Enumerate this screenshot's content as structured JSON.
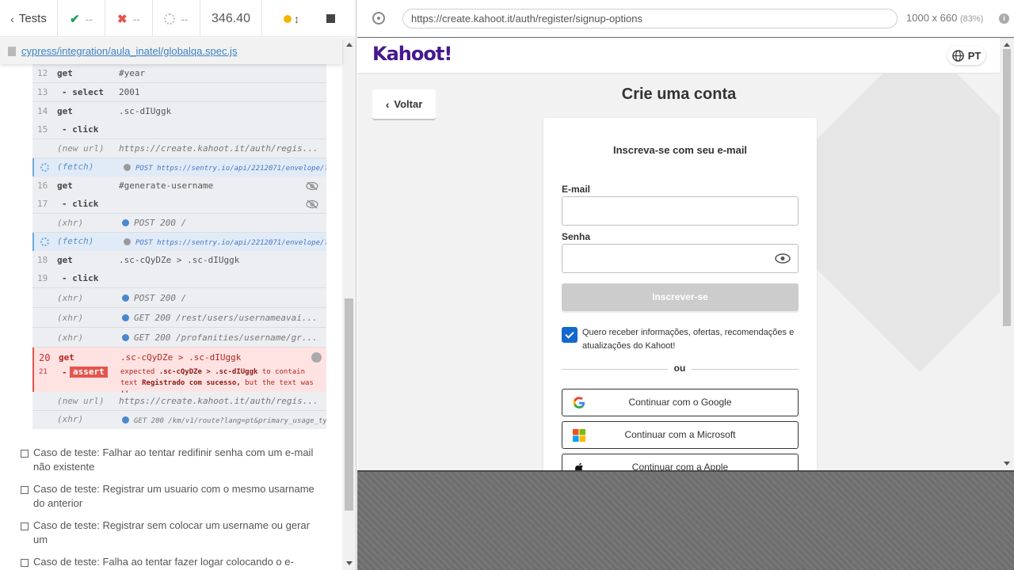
{
  "topbar": {
    "tests_label": "Tests",
    "passed": "--",
    "failed": "--",
    "pending": "--",
    "duration": "346.40"
  },
  "spec": {
    "path": "cypress/integration/aula_inatel/globalqa.spec.js"
  },
  "command_log": [
    {
      "num": "12",
      "cmd": "get",
      "arg": "#year"
    },
    {
      "num": "13",
      "cmd": "- select",
      "arg": "2001"
    },
    {
      "num": "14",
      "cmd": "get",
      "arg": ".sc-dIUggk"
    },
    {
      "num": "15",
      "cmd": "- click",
      "arg": ""
    },
    {
      "num": "",
      "cmd": "(new url)",
      "arg": "https://create.kahoot.it/auth/regis..."
    },
    {
      "num": "",
      "cmd": "(fetch)",
      "arg": "POST https://sentry.io/api/2212071/envelope/?s..."
    },
    {
      "num": "16",
      "cmd": "get",
      "arg": "#generate-username"
    },
    {
      "num": "17",
      "cmd": "- click",
      "arg": ""
    },
    {
      "num": "",
      "cmd": "(xhr)",
      "arg": "POST 200 /"
    },
    {
      "num": "",
      "cmd": "(fetch)",
      "arg": "POST https://sentry.io/api/2212071/envelope/?s..."
    },
    {
      "num": "18",
      "cmd": "get",
      "arg": ".sc-cQyDZe > .sc-dIUggk"
    },
    {
      "num": "19",
      "cmd": "- click",
      "arg": ""
    },
    {
      "num": "",
      "cmd": "(xhr)",
      "arg": "POST 200 /"
    },
    {
      "num": "",
      "cmd": "(xhr)",
      "arg": "GET 200 /rest/users/usernameavai..."
    },
    {
      "num": "",
      "cmd": "(xhr)",
      "arg": "GET 200 /profanities/username/gr..."
    },
    {
      "num": "20",
      "cmd": "get",
      "arg": ".sc-cQyDZe > .sc-dIUggk"
    },
    {
      "num": "21",
      "cmd": "-",
      "arg": "assert"
    },
    {
      "num": "",
      "cmd": "(new url)",
      "arg": "https://create.kahoot.it/auth/regis..."
    },
    {
      "num": "",
      "cmd": "(xhr)",
      "arg": "GET 200 /km/v1/route?lang=pt&primary_usage_typ..."
    }
  ],
  "assertion": {
    "pre": "expected",
    "selector": ".sc-cQyDZe > .sc-dIUggk",
    "mid": "to contain text",
    "expected_text": "Registrado com sucesso,",
    "post": "but the text was",
    "actual": "''"
  },
  "tests": [
    "Caso de teste: Falhar ao tentar redifinir senha com um e-mail não existente",
    "Caso de teste: Registrar um usuario com o mesmo usarname do anterior",
    "Caso de teste: Registrar sem colocar um username ou gerar um",
    "Caso de teste: Falha ao tentar fazer logar colocando o e-"
  ],
  "browser": {
    "url": "https://create.kahoot.it/auth/register/signup-options",
    "viewport": "1000 x 660",
    "scale": "(83%)"
  },
  "app": {
    "logo": "Kahoot!",
    "lang": "PT",
    "back_label": "Voltar",
    "title": "Crie uma conta",
    "card_title": "Inscreva-se com seu e-mail",
    "email_label": "E-mail",
    "password_label": "Senha",
    "submit_label": "Inscrever-se",
    "consent_text": "Quero receber informações, ofertas, recomendações e atualizações do Kahoot!",
    "or_label": "ou",
    "google_label": "Continuar com o Google",
    "microsoft_label": "Continuar com a Microsoft",
    "apple_label": "Continuar com a Apple"
  },
  "colors": {
    "kahoot_purple": "#46178f",
    "pass_green": "#1f9d55",
    "fail_red": "#e4554e",
    "checkbox_blue": "#1368ce"
  }
}
